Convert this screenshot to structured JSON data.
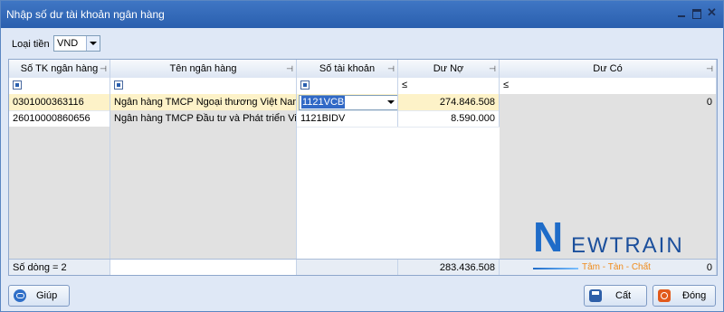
{
  "window": {
    "title": "Nhập số dư tài khoản ngân hàng",
    "close_glyph": "✕"
  },
  "currency": {
    "label": "Loại tiền",
    "selected": "VND"
  },
  "grid": {
    "columns": [
      "Số TK ngân hàng",
      "Tên ngân hàng",
      "Số tài khoản",
      "Dư Nợ",
      "Dư Có"
    ],
    "pin_glyph": "⊣",
    "filter_le": "≤",
    "rows": [
      {
        "account_no": "0301000363116",
        "bank_name": "Ngân hàng TMCP Ngoại thương Việt Nam",
        "gl_account": "1121VCB",
        "debit": "274.846.508",
        "credit": "0"
      },
      {
        "account_no": "26010000860656",
        "bank_name": "Ngân hàng TMCP Đầu tư và Phát triển Việ",
        "gl_account": "1121BIDV",
        "debit": "8.590.000",
        "credit": ""
      }
    ],
    "footer": {
      "row_count": "Số dòng = 2",
      "total_debit": "283.436.508",
      "total_credit": "0"
    }
  },
  "logo": {
    "first_letter": "N",
    "rest": "EWTRAIN",
    "tagline": "Tâm - Tàn - Chất"
  },
  "buttons": {
    "help": "Giúp",
    "save": "Cất",
    "close": "Đóng"
  }
}
